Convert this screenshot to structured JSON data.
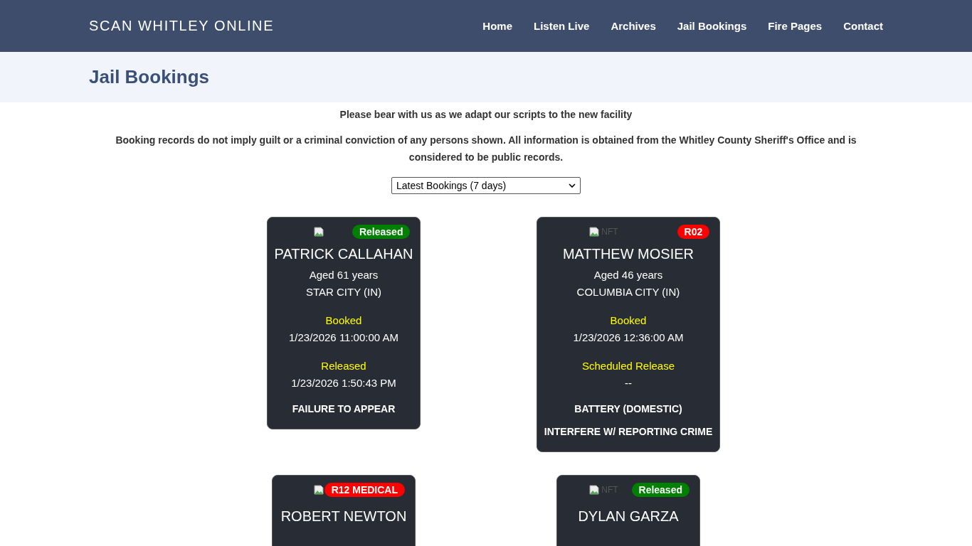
{
  "site_title": "SCAN WHITLEY ONLINE",
  "nav": [
    {
      "label": "Home"
    },
    {
      "label": "Listen Live"
    },
    {
      "label": "Archives"
    },
    {
      "label": "Jail Bookings"
    },
    {
      "label": "Fire Pages"
    },
    {
      "label": "Contact"
    }
  ],
  "page_title": "Jail Bookings",
  "notice": "Please bear with us as we adapt our scripts to the new facility",
  "disclaimer": "Booking records do not imply guilt or a criminal conviction of any persons shown. All information is obtained from the Whitley County Sheriff's Office and is considered to be public records.",
  "filter": {
    "value": "Latest Bookings (7 days)"
  },
  "bookings": [
    {
      "name": "PATRICK CALLAHAN",
      "badge": {
        "text": "Released",
        "color": "#008000"
      },
      "age": "Aged 61 years",
      "city": "STAR CITY (IN)",
      "booked_label": "Booked",
      "booked": "1/23/2026 11:00:00 AM",
      "release_label": "Released",
      "release": "1/23/2026 1:50:43 PM",
      "charges": [
        "FAILURE TO APPEAR"
      ]
    },
    {
      "name": "MATTHEW MOSIER",
      "badge": {
        "text": "R02",
        "color": "#ff0000"
      },
      "image_alt": "NFT",
      "age": "Aged 46 years",
      "city": "COLUMBIA CITY (IN)",
      "booked_label": "Booked",
      "booked": "1/23/2026 12:36:00 AM",
      "release_label": "Scheduled Release",
      "release": "--",
      "charges": [
        "BATTERY (DOMESTIC)",
        "INTERFERE W/ REPORTING CRIME"
      ]
    },
    {
      "name": "ROBERT NEWTON",
      "badge": {
        "text": "R12 MEDICAL",
        "color": "#ff0000"
      }
    },
    {
      "name": "DYLAN GARZA",
      "badge": {
        "text": "Released",
        "color": "#008000"
      },
      "image_alt": "NFT"
    }
  ]
}
